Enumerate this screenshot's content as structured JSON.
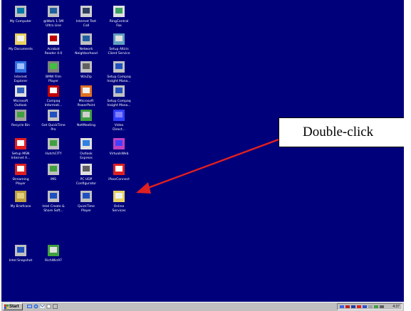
{
  "desktop": {
    "background": "#00007b",
    "icons": [
      {
        "label": "My Computer",
        "glyph": "computer-icon",
        "c1": "#c0c0c0",
        "c2": "#0078a8"
      },
      {
        "label": "@Work 1.5M\nUltra Line",
        "glyph": "network-icon",
        "c1": "#c0c0c0",
        "c2": "#2060a0"
      },
      {
        "label": "Internet Test\nCall",
        "glyph": "phone-icon",
        "c1": "#d0d0d0",
        "c2": "#304060"
      },
      {
        "label": "RingCentral\nFax",
        "glyph": "fax-icon",
        "c1": "#e0e0e0",
        "c2": "#3aa060"
      },
      {
        "label": "My Documents",
        "glyph": "folder-icon",
        "c1": "#e8d060",
        "c2": "#f0f0f0"
      },
      {
        "label": "Acrobat\nReader 4.0",
        "glyph": "acrobat-icon",
        "c1": "#f0f0f0",
        "c2": "#c00000"
      },
      {
        "label": "Network\nNeighborhood",
        "glyph": "network-neighborhood-icon",
        "c1": "#c0c0c0",
        "c2": "#2060a0"
      },
      {
        "label": "Setup Altiris\nClient Service",
        "glyph": "setup-icon",
        "c1": "#60a0c0",
        "c2": "#e0e0e0"
      },
      {
        "label": "Internet\nExplorer",
        "glyph": "ie-icon",
        "c1": "#3070e0",
        "c2": "#a0c0ff"
      },
      {
        "label": "BMW Film\nPlayer",
        "glyph": "film-player-icon",
        "c1": "#808080",
        "c2": "#40c040"
      },
      {
        "label": "WinZip",
        "glyph": "winzip-icon",
        "c1": "#c0c0c0",
        "c2": "#606060"
      },
      {
        "label": "Setup Compaq\nInsight Mana...",
        "glyph": "compaq-setup-icon",
        "c1": "#c0c0c0",
        "c2": "#2050c0"
      },
      {
        "label": "Microsoft\nOutlook",
        "glyph": "outlook-icon",
        "c1": "#e0e0e0",
        "c2": "#3060c0"
      },
      {
        "label": "Compaq\nInformati...",
        "glyph": "compaq-info-icon",
        "c1": "#c00000",
        "c2": "#ffffff"
      },
      {
        "label": "Microsoft\nPowerPoint",
        "glyph": "powerpoint-icon",
        "c1": "#e07020",
        "c2": "#f0f0f0"
      },
      {
        "label": "Setup Compaq\nInsight Mana...",
        "glyph": "compaq-setup-icon",
        "c1": "#c0c0c0",
        "c2": "#2050c0"
      },
      {
        "label": "Recycle Bin",
        "glyph": "recycle-bin-icon",
        "c1": "#a0a0a0",
        "c2": "#40a040"
      },
      {
        "label": "Get QuickTime\nPro",
        "glyph": "quicktime-icon",
        "c1": "#c0c0c0",
        "c2": "#2050c0"
      },
      {
        "label": "NetMeeting",
        "glyph": "netmeeting-icon",
        "c1": "#40a040",
        "c2": "#d0d0d0"
      },
      {
        "label": "Video\nDirect...",
        "glyph": "video-icon",
        "c1": "#3040ff",
        "c2": "#8080ff"
      },
      {
        "label": "Setup MSN\nInternet A...",
        "glyph": "msn-icon",
        "c1": "#e02020",
        "c2": "#ffffff"
      },
      {
        "label": "HutchCITY",
        "glyph": "hutchcity-icon",
        "c1": "#c0c0c0",
        "c2": "#40a040"
      },
      {
        "label": "Outlook\nExpress",
        "glyph": "outlook-express-icon",
        "c1": "#e0e0e0",
        "c2": "#3080e0"
      },
      {
        "label": "VirtualsWeb",
        "glyph": "web-icon",
        "c1": "#c040c0",
        "c2": "#4040ff"
      },
      {
        "label": "Streaming\nPlayer",
        "glyph": "streaming-player-icon",
        "c1": "#e02020",
        "c2": "#ffffff"
      },
      {
        "label": "IMS",
        "glyph": "ims-icon",
        "c1": "#c0c0c0",
        "c2": "#40a040"
      },
      {
        "label": "PC UDP\nConfigurator",
        "glyph": "configurator-icon",
        "c1": "#e0e0e0",
        "c2": "#606060"
      },
      {
        "label": "iPassConnect",
        "glyph": "ipassconnect-icon",
        "c1": "#e02020",
        "c2": "#ffffff"
      },
      {
        "label": "My Briefcase",
        "glyph": "briefcase-icon",
        "c1": "#c0a040",
        "c2": "#e0d080"
      },
      {
        "label": "Intel Create &\nShare Soft...",
        "glyph": "intel-icon",
        "c1": "#c0c0c0",
        "c2": "#2050c0"
      },
      {
        "label": "QuickTime\nPlayer",
        "glyph": "quicktime-player-icon",
        "c1": "#c0c0c0",
        "c2": "#2050c0"
      },
      {
        "label": "Online\nServices",
        "glyph": "online-services-icon",
        "c1": "#e8d060",
        "c2": "#f0f0f0"
      },
      {
        "label": "Intel Snapshot",
        "glyph": "snapshot-icon",
        "c1": "#c0c0c0",
        "c2": "#2050c0"
      },
      {
        "label": "RichWin97",
        "glyph": "richwin-icon",
        "c1": "#40a040",
        "c2": "#e0e0e0"
      }
    ]
  },
  "callout": {
    "text": "Double-click",
    "arrow_color": "#e02020"
  },
  "taskbar": {
    "start_label": "Start",
    "clock": "4:37"
  }
}
